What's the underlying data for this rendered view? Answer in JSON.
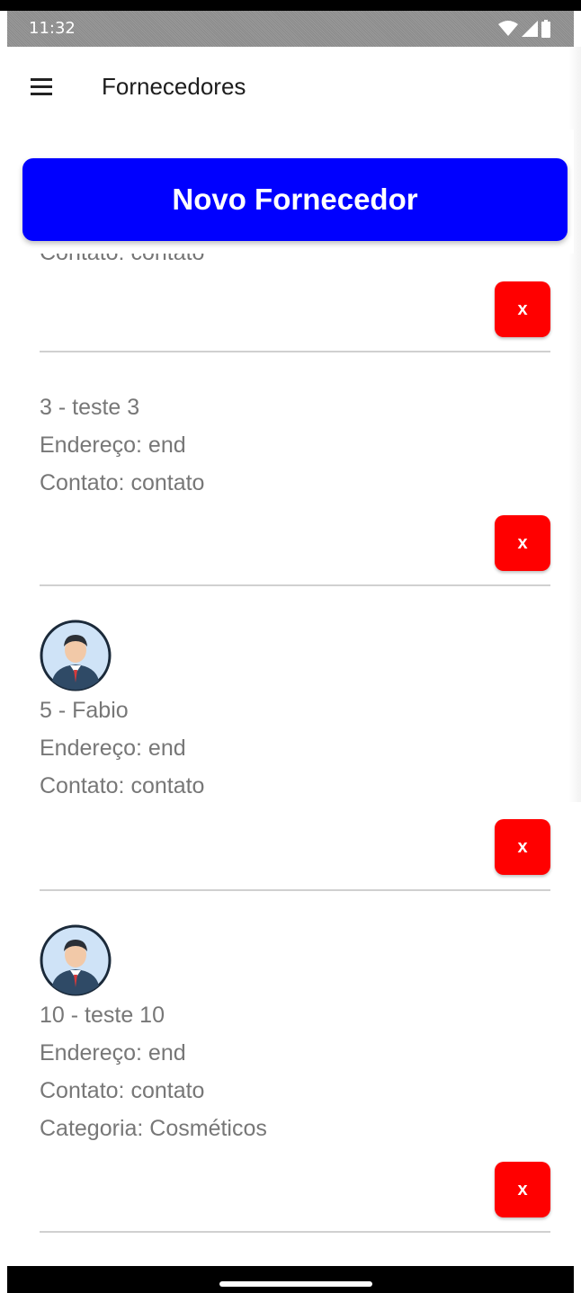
{
  "status_bar": {
    "time": "11:32"
  },
  "app_bar": {
    "title": "Fornecedores"
  },
  "new_button": {
    "label": "Novo Fornecedor"
  },
  "delete_label": "x",
  "suppliers": [
    {
      "title": "",
      "address": "",
      "contact": "Contato: contato",
      "category": "",
      "has_avatar": false
    },
    {
      "title": "3 - teste 3",
      "address": "Endereço: end",
      "contact": "Contato: contato",
      "category": "",
      "has_avatar": false
    },
    {
      "title": "5 - Fabio",
      "address": "Endereço: end",
      "contact": "Contato: contato",
      "category": "",
      "has_avatar": true
    },
    {
      "title": "10 - teste 10",
      "address": "Endereço: end",
      "contact": "Contato: contato",
      "category": "Categoria: Cosméticos",
      "has_avatar": true
    }
  ],
  "colors": {
    "primary_button": "#0000ff",
    "delete_button": "#ff0000",
    "text_secondary": "#777777"
  },
  "icons": [
    "menu-icon",
    "wifi-icon",
    "signal-icon",
    "battery-icon",
    "avatar-icon"
  ]
}
